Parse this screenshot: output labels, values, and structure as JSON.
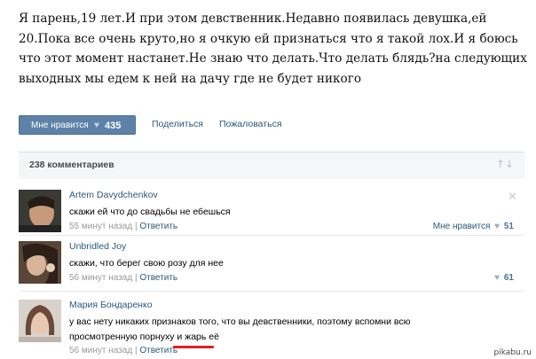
{
  "post": {
    "text": "Я парень,19 лет.И при этом девственник.Недавно появилась девушка,ей 20.Пока все очень круто,но я очкую ей признаться что я такой лох.И я боюсь что этот момент настанет.Не знаю что делать.Что делать блядь?на следующих выходных мы едем к ней на дачу где не будет никого"
  },
  "actions": {
    "like_label": "Мне нравится",
    "like_heart": "♥",
    "like_count": "435",
    "share_label": "Поделиться",
    "report_label": "Пожаловаться"
  },
  "comments_header": {
    "count_label": "238 комментариев",
    "sort_icon": "↑↓"
  },
  "comments": [
    {
      "author": "Artem Davydchenkov",
      "text": "скажи ей что до свадьбы не ебешься",
      "time": "55 минут назад",
      "sep": " | ",
      "reply": "Ответить",
      "likes_label": "Мне нравится",
      "likes": "51"
    },
    {
      "author": "Unbridled Joy",
      "text": "скажи, что берег свою розу для нее",
      "time": "56 минут назад",
      "sep": " | ",
      "reply": "Ответить",
      "likes": "61"
    },
    {
      "author": "Мария Бондаренко",
      "text": "у вас нету никаких признаков того, что вы девственники, поэтому вспомни всю просмотренную порнуху и жарь её",
      "time": "56 минут назад",
      "sep": " | ",
      "reply": "Ответить"
    }
  ],
  "close_icon": "✕",
  "watermark": "pikabu.ru",
  "colors": {
    "accent": "#5e81a8",
    "link": "#2b587a",
    "muted": "#999999",
    "highlight": "#e02020"
  }
}
